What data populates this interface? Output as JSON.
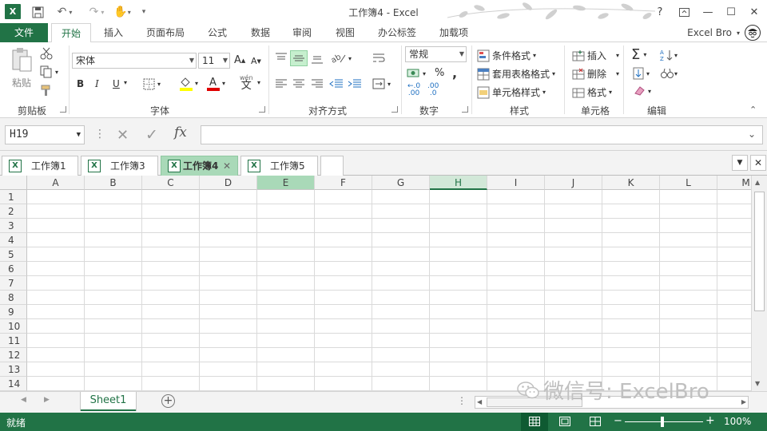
{
  "titlebar": {
    "title": "工作簿4 - Excel",
    "help": "?",
    "app_logo": "X"
  },
  "ribbon_tabs": {
    "file": "文件",
    "tabs": [
      "开始",
      "插入",
      "页面布局",
      "公式",
      "数据",
      "审阅",
      "视图",
      "办公标签",
      "加载项"
    ],
    "active": "开始",
    "user": "Excel Bro"
  },
  "ribbon": {
    "clipboard": {
      "label": "剪贴板",
      "paste": "粘贴"
    },
    "font": {
      "label": "字体",
      "font_name": "宋体",
      "font_size": "11",
      "bold": "B",
      "italic": "I",
      "underline": "U",
      "wen_top": "wén",
      "wen": "文"
    },
    "alignment": {
      "label": "对齐方式"
    },
    "number": {
      "label": "数字",
      "format": "常规",
      "percent": "%",
      "comma": ",",
      "inc_decimal": ".00",
      "dec_decimal": ".0"
    },
    "styles": {
      "label": "样式",
      "conditional": "条件格式",
      "table_format": "套用表格格式",
      "cell_styles": "单元格样式"
    },
    "cells": {
      "label": "单元格",
      "insert": "插入",
      "delete": "删除",
      "format": "格式"
    },
    "editing": {
      "label": "编辑"
    }
  },
  "formula_bar": {
    "name_box": "H19",
    "fx": "fx",
    "formula": ""
  },
  "workbook_tabs": [
    {
      "label": "工作簿1",
      "active": false
    },
    {
      "label": "工作簿3",
      "active": false
    },
    {
      "label": "工作簿4",
      "active": true
    },
    {
      "label": "工作簿5",
      "active": false
    }
  ],
  "grid": {
    "columns": [
      "A",
      "B",
      "C",
      "D",
      "E",
      "F",
      "G",
      "H",
      "I",
      "J",
      "K",
      "L",
      "M"
    ],
    "rows": [
      "1",
      "2",
      "3",
      "4",
      "5",
      "6",
      "7",
      "8",
      "9",
      "10",
      "11",
      "12",
      "13",
      "14"
    ],
    "selected_column": "H",
    "highlight_column": "E"
  },
  "sheets": {
    "tabs": [
      "Sheet1"
    ],
    "active": "Sheet1",
    "add": "+"
  },
  "status": {
    "text": "就绪",
    "zoom": "100%"
  },
  "watermark": "微信号: ExcelBro",
  "colors": {
    "accent": "#217346",
    "selected_tab": "#a9d9b8"
  }
}
